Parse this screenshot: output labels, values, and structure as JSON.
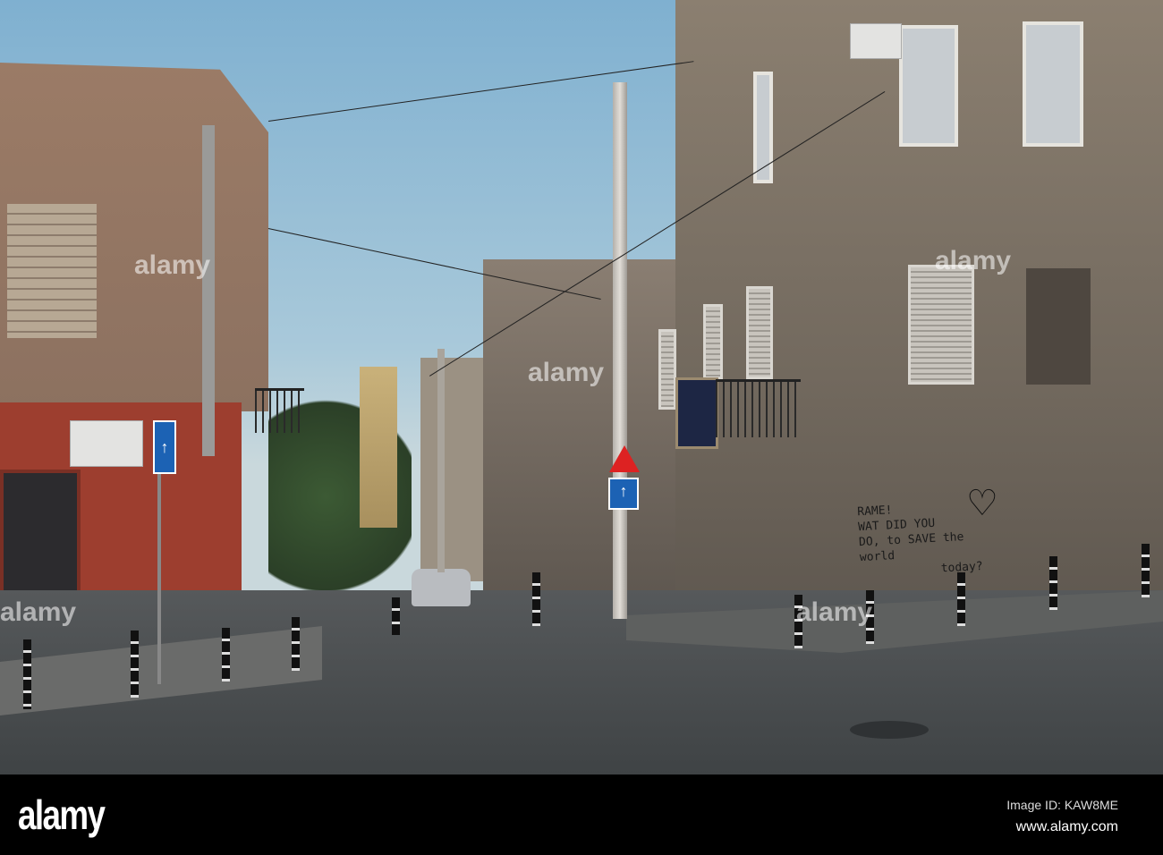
{
  "photo": {
    "description_label": "street",
    "graffiti_lines": [
      "RAME!",
      "WAT DID YOU",
      "DO, to SAVE the world",
      "today?"
    ],
    "watermark": "alamy"
  },
  "footer": {
    "logo": "alamy",
    "image_id": "Image ID: KAW8ME",
    "website": "www.alamy.com"
  }
}
